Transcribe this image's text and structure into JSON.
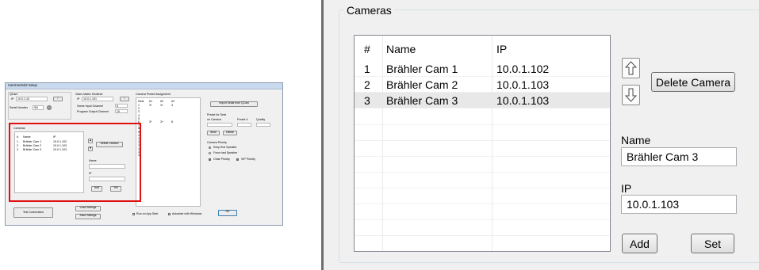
{
  "thumbnail": {
    "title": "CamControl2 Setup",
    "qcam": {
      "label": "QCam",
      "ip_label": "IP",
      "ip_value": "10.0.1.10",
      "serial_label": "Serial Number",
      "serial_value": "SN"
    },
    "video_switcher": {
      "label": "Video Matrix Switcher",
      "ip_label": "IP",
      "ip_value": "10.0.1.101",
      "home_label": "Home Input Channel",
      "home_value": "5",
      "program_label": "Program Output Channel",
      "program_value": "10"
    },
    "preset_assignment": {
      "label": "Camera Preset Assignment",
      "headers": [
        "Seat",
        "#1",
        "#2",
        "#3"
      ],
      "rows": [
        [
          "1",
          "3*",
          "3+",
          "3"
        ],
        [
          "2",
          "",
          "",
          ""
        ],
        [
          "3",
          "",
          "",
          ""
        ],
        [
          "4",
          "",
          "",
          ""
        ],
        [
          "5",
          "",
          "",
          ""
        ],
        [
          "6",
          "3*",
          "3+",
          "8"
        ],
        [
          "7",
          "",
          "",
          ""
        ],
        [
          "8",
          "",
          "",
          ""
        ],
        [
          "9",
          "",
          "",
          ""
        ],
        [
          "10",
          "",
          "",
          ""
        ],
        [
          "11",
          "",
          "",
          ""
        ],
        [
          "12",
          "",
          "",
          ""
        ],
        [
          "13",
          "",
          "",
          ""
        ],
        [
          "14",
          "",
          "",
          ""
        ],
        [
          "15",
          "",
          "",
          ""
        ],
        [
          "16",
          "",
          "",
          ""
        ]
      ]
    },
    "import_button": "Import Seats from QCam",
    "preset_for_seat": {
      "label": "Preset for Seat",
      "camera_label": "on Camera",
      "preset_label": "Preset #",
      "quality_label": "Quality",
      "store_button": "Store",
      "delete_button": "Delete"
    },
    "camera_priority": {
      "label": "Camera Priority",
      "option_keep": "Keep first Speaker",
      "option_force": "Force last Speaker",
      "chair_label": "Chair Priority",
      "vip_label": "VIP Priority"
    },
    "cameras_label": "Cameras",
    "cameras_headers": [
      "#",
      "Name",
      "IP"
    ],
    "cameras_rows": [
      [
        "1",
        "Brähler Cam 1",
        "10.0.1.102"
      ],
      [
        "2",
        "Brähler Cam 2",
        "10.0.1.103"
      ],
      [
        "3",
        "Brähler Cam 3",
        "10.0.1.103"
      ]
    ],
    "delete_camera_button": "Delete Camera",
    "name_label": "Name",
    "ip_label": "IP",
    "add_button": "Add",
    "set_button": "Set",
    "test_connections_button": "Test Connections",
    "load_settings_button": "Load Settings",
    "save_settings_button": "Save Settings",
    "run_on_start_label": "Run on App Start",
    "autostart_label": "Autostart with Windows",
    "ok_button": "OK"
  },
  "cameras_panel": {
    "group_title": "Cameras",
    "columns": [
      "#",
      "Name",
      "IP"
    ],
    "rows": [
      {
        "num": "1",
        "name": "Brähler Cam 1",
        "ip": "10.0.1.102"
      },
      {
        "num": "2",
        "name": "Brähler Cam 2",
        "ip": "10.0.1.103"
      },
      {
        "num": "3",
        "name": "Brähler Cam 3",
        "ip": "10.0.1.103"
      }
    ],
    "selected_row": 3,
    "move_up_icon": "arrow-up-icon",
    "move_down_icon": "arrow-down-icon",
    "delete_camera_button": "Delete Camera",
    "name_label": "Name",
    "name_value": "Brähler Cam 3",
    "ip_label": "IP",
    "ip_value": "10.0.1.103",
    "add_button": "Add",
    "set_button": "Set"
  },
  "colors": {
    "highlight": "#e01010",
    "window_bg": "#f0f0f0",
    "selected_row": "#e8e8e8"
  }
}
